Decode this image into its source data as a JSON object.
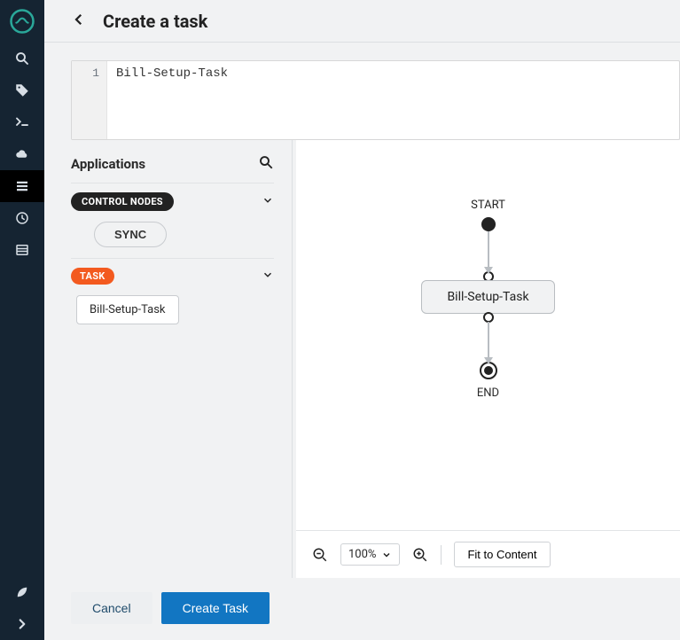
{
  "header": {
    "title": "Create a task"
  },
  "editor": {
    "line_number": "1",
    "content": "Bill-Setup-Task"
  },
  "palette": {
    "title": "Applications",
    "groups": {
      "control": {
        "label": "CONTROL NODES",
        "item_label": "SYNC"
      },
      "task": {
        "label": "TASK",
        "item_label": "Bill-Setup-Task"
      }
    }
  },
  "canvas": {
    "start_label": "START",
    "task_label": "Bill-Setup-Task",
    "end_label": "END"
  },
  "toolbar": {
    "zoom_value": "100%",
    "fit_label": "Fit to Content"
  },
  "footer": {
    "cancel_label": "Cancel",
    "create_label": "Create Task"
  }
}
